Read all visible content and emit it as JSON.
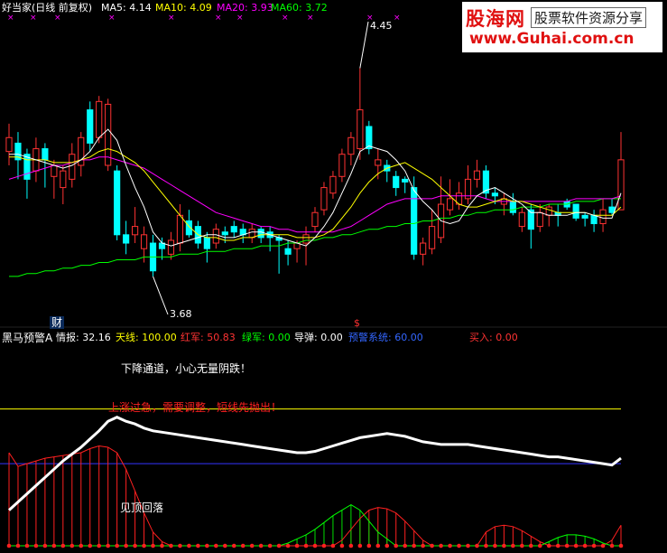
{
  "top_header": {
    "title": "好当家(日线 前复权)",
    "ma": [
      {
        "label": "MA5:",
        "value": "4.14",
        "color": "#ffffff"
      },
      {
        "label": "MA10:",
        "value": "4.09",
        "color": "#ffff00"
      },
      {
        "label": "MA20:",
        "value": "3.93",
        "color": "#ff00ff"
      },
      {
        "label": "MA60:",
        "value": "3.72",
        "color": "#00ff00"
      }
    ]
  },
  "logo": {
    "main": "股海网",
    "tagline": "股票软件资源分享",
    "url": "www.Guhai.com.cn"
  },
  "price_annotations": {
    "high": "4.45",
    "low": "3.68"
  },
  "markers": {
    "cai": "财",
    "s": "$"
  },
  "indicator_header": {
    "name": "黑马预警A",
    "items": [
      {
        "label": "情报:",
        "value": "32.16",
        "color": "#ffffff"
      },
      {
        "label": "天线:",
        "value": "100.00",
        "color": "#ffff00"
      },
      {
        "label": "红军:",
        "value": "50.83",
        "color": "#ff3333"
      },
      {
        "label": "绿军:",
        "value": "0.00",
        "color": "#00ff00"
      },
      {
        "label": "导弹:",
        "value": "0.00",
        "color": "#ffffff"
      },
      {
        "label": "预警系统:",
        "value": "60.00",
        "color": "#3366ff"
      },
      {
        "label": "买入:",
        "value": "0.00",
        "color": "#ff3333"
      }
    ]
  },
  "indicator_annotations": {
    "a1": "下降通道，小心无量阴跌！",
    "a2": "上涨过急，需要调整，短线先抛出！",
    "a3": "见顶回落"
  },
  "colors": {
    "up": "#ff3232",
    "down": "#00ffff",
    "ma5": "#ffffff",
    "ma10": "#ffff00",
    "ma20": "#ff00ff",
    "ma60": "#00ff00",
    "warn_line": "#3333ff",
    "sky_line": "#ffff00"
  },
  "chart_data": {
    "type": "candlestick",
    "candles": [
      [
        4.15,
        4.2,
        4.1,
        4.25
      ],
      [
        4.18,
        4.12,
        4.05,
        4.22
      ],
      [
        4.14,
        4.05,
        3.98,
        4.16
      ],
      [
        4.08,
        4.16,
        4.04,
        4.2
      ],
      [
        4.16,
        4.12,
        4.02,
        4.18
      ],
      [
        4.06,
        4.1,
        3.98,
        4.12
      ],
      [
        4.02,
        4.08,
        3.96,
        4.1
      ],
      [
        4.05,
        4.14,
        4.02,
        4.18
      ],
      [
        4.1,
        4.2,
        4.06,
        4.22
      ],
      [
        4.3,
        4.18,
        4.15,
        4.33
      ],
      [
        4.2,
        4.33,
        4.18,
        4.35
      ],
      [
        4.1,
        4.32,
        4.08,
        4.34
      ],
      [
        4.08,
        3.85,
        3.83,
        4.1
      ],
      [
        3.85,
        3.82,
        3.78,
        3.9
      ],
      [
        3.85,
        3.88,
        3.82,
        3.95
      ],
      [
        3.8,
        3.85,
        3.75,
        3.88
      ],
      [
        3.82,
        3.72,
        3.7,
        3.85
      ],
      [
        3.82,
        3.8,
        3.76,
        3.84
      ],
      [
        3.78,
        3.83,
        3.76,
        3.86
      ],
      [
        3.82,
        3.92,
        3.79,
        3.96
      ],
      [
        3.9,
        3.85,
        3.84,
        3.94
      ],
      [
        3.88,
        3.82,
        3.8,
        3.9
      ],
      [
        3.84,
        3.8,
        3.75,
        3.86
      ],
      [
        3.82,
        3.87,
        3.8,
        3.89
      ],
      [
        3.86,
        3.85,
        3.82,
        3.88
      ],
      [
        3.88,
        3.86,
        3.84,
        3.9
      ],
      [
        3.87,
        3.85,
        3.82,
        3.89
      ],
      [
        3.84,
        3.87,
        3.82,
        3.89
      ],
      [
        3.87,
        3.84,
        3.82,
        3.88
      ],
      [
        3.86,
        3.84,
        3.79,
        3.88
      ],
      [
        3.84,
        3.83,
        3.71,
        3.85
      ],
      [
        3.8,
        3.78,
        3.74,
        3.83
      ],
      [
        3.8,
        3.82,
        3.75,
        3.83
      ],
      [
        3.82,
        3.85,
        3.74,
        3.88
      ],
      [
        3.88,
        3.93,
        3.86,
        3.95
      ],
      [
        3.94,
        4.02,
        3.92,
        4.04
      ],
      [
        4.0,
        4.06,
        3.98,
        4.08
      ],
      [
        4.06,
        4.14,
        4.04,
        4.16
      ],
      [
        4.14,
        4.2,
        4.1,
        4.22
      ],
      [
        4.16,
        4.3,
        4.12,
        4.45
      ],
      [
        4.24,
        4.16,
        4.14,
        4.26
      ],
      [
        4.1,
        4.12,
        4.05,
        4.16
      ],
      [
        4.1,
        4.08,
        4.04,
        4.12
      ],
      [
        4.06,
        4.02,
        3.99,
        4.08
      ],
      [
        4.05,
        4.04,
        4.0,
        4.06
      ],
      [
        4.02,
        3.78,
        3.76,
        4.06
      ],
      [
        3.78,
        3.82,
        3.74,
        3.84
      ],
      [
        3.8,
        3.88,
        3.78,
        3.94
      ],
      [
        3.84,
        3.96,
        3.82,
        4.06
      ],
      [
        3.94,
        3.98,
        3.92,
        4.05
      ],
      [
        3.96,
        4.0,
        3.94,
        4.04
      ],
      [
        3.98,
        4.05,
        3.96,
        4.1
      ],
      [
        4.05,
        4.08,
        4.02,
        4.12
      ],
      [
        4.08,
        4.0,
        3.98,
        4.1
      ],
      [
        4.0,
        3.99,
        3.96,
        4.02
      ],
      [
        3.96,
        3.98,
        3.92,
        4.0
      ],
      [
        3.97,
        3.93,
        3.92,
        4.0
      ],
      [
        3.88,
        3.93,
        3.86,
        3.95
      ],
      [
        3.94,
        3.87,
        3.8,
        3.96
      ],
      [
        3.88,
        3.93,
        3.86,
        3.96
      ],
      [
        3.92,
        3.95,
        3.88,
        3.96
      ],
      [
        3.93,
        3.92,
        3.88,
        3.96
      ],
      [
        3.97,
        3.95,
        3.94,
        3.98
      ],
      [
        3.96,
        3.91,
        3.9,
        3.96
      ],
      [
        3.92,
        3.91,
        3.88,
        3.93
      ],
      [
        3.92,
        3.89,
        3.86,
        3.94
      ],
      [
        3.89,
        3.94,
        3.86,
        3.98
      ],
      [
        3.95,
        3.93,
        3.92,
        3.98
      ],
      [
        3.94,
        4.12,
        3.94,
        4.22
      ]
    ],
    "ma5": [
      4.14,
      4.14,
      4.13,
      4.12,
      4.11,
      4.1,
      4.09,
      4.1,
      4.12,
      4.15,
      4.2,
      4.23,
      4.19,
      4.1,
      4.02,
      3.95,
      3.86,
      3.82,
      3.81,
      3.82,
      3.83,
      3.84,
      3.85,
      3.85,
      3.84,
      3.84,
      3.85,
      3.86,
      3.86,
      3.85,
      3.84,
      3.83,
      3.82,
      3.81,
      3.84,
      3.88,
      3.93,
      4.0,
      4.07,
      4.15,
      4.17,
      4.16,
      4.15,
      4.12,
      4.08,
      4.01,
      3.97,
      3.94,
      3.9,
      3.89,
      3.9,
      3.95,
      3.99,
      4.01,
      4.02,
      4.0,
      3.98,
      3.96,
      3.93,
      3.93,
      3.92,
      3.92,
      3.92,
      3.93,
      3.93,
      3.92,
      3.91,
      3.91,
      4.0
    ],
    "ma10": [
      4.13,
      4.13,
      4.12,
      4.12,
      4.12,
      4.11,
      4.11,
      4.11,
      4.12,
      4.13,
      4.15,
      4.16,
      4.15,
      4.13,
      4.11,
      4.08,
      4.04,
      4.0,
      3.96,
      3.92,
      3.88,
      3.85,
      3.84,
      3.84,
      3.83,
      3.83,
      3.84,
      3.84,
      3.85,
      3.85,
      3.85,
      3.85,
      3.84,
      3.84,
      3.84,
      3.85,
      3.87,
      3.91,
      3.95,
      4.0,
      4.04,
      4.07,
      4.09,
      4.1,
      4.11,
      4.09,
      4.07,
      4.05,
      4.02,
      3.99,
      3.96,
      3.95,
      3.95,
      3.96,
      3.97,
      3.98,
      3.97,
      3.97,
      3.96,
      3.95,
      3.94,
      3.93,
      3.93,
      3.93,
      3.93,
      3.92,
      3.92,
      3.92,
      3.95
    ],
    "ma20": [
      4.05,
      4.06,
      4.07,
      4.08,
      4.09,
      4.1,
      4.1,
      4.11,
      4.12,
      4.12,
      4.13,
      4.13,
      4.12,
      4.11,
      4.1,
      4.09,
      4.07,
      4.05,
      4.03,
      4.01,
      3.99,
      3.97,
      3.95,
      3.93,
      3.92,
      3.91,
      3.9,
      3.89,
      3.88,
      3.88,
      3.87,
      3.87,
      3.86,
      3.86,
      3.86,
      3.86,
      3.86,
      3.87,
      3.88,
      3.9,
      3.92,
      3.94,
      3.96,
      3.97,
      3.98,
      3.98,
      3.98,
      3.98,
      3.99,
      3.99,
      3.99,
      3.99,
      3.99,
      3.98,
      3.97,
      3.97,
      3.97,
      3.97,
      3.97,
      3.97,
      3.97,
      3.97,
      3.97,
      3.98,
      3.98,
      3.98,
      3.98,
      3.98,
      3.99
    ],
    "ma60": [
      3.7,
      3.7,
      3.71,
      3.71,
      3.72,
      3.72,
      3.73,
      3.73,
      3.74,
      3.74,
      3.75,
      3.75,
      3.76,
      3.76,
      3.76,
      3.77,
      3.77,
      3.77,
      3.77,
      3.78,
      3.78,
      3.78,
      3.79,
      3.79,
      3.79,
      3.8,
      3.8,
      3.8,
      3.81,
      3.81,
      3.81,
      3.82,
      3.82,
      3.83,
      3.83,
      3.84,
      3.84,
      3.85,
      3.85,
      3.86,
      3.87,
      3.87,
      3.88,
      3.88,
      3.89,
      3.89,
      3.9,
      3.9,
      3.91,
      3.91,
      3.92,
      3.92,
      3.93,
      3.93,
      3.94,
      3.94,
      3.94,
      3.95,
      3.95,
      3.95,
      3.96,
      3.96,
      3.96,
      3.97,
      3.97,
      3.97,
      3.98,
      3.98,
      3.98
    ],
    "ylim": [
      3.55,
      4.65
    ],
    "indicator": {
      "ylim": [
        0,
        140
      ],
      "white_line": [
        26,
        32,
        38,
        44,
        50,
        56,
        62,
        67,
        72,
        78,
        84,
        91,
        94,
        91,
        89,
        86,
        84,
        83,
        82,
        81,
        80,
        79,
        78,
        77,
        76,
        75,
        74,
        73,
        72,
        71,
        70,
        69,
        68,
        68,
        69,
        71,
        73,
        75,
        77,
        79,
        80,
        81,
        82,
        81,
        80,
        78,
        76,
        75,
        74,
        74,
        74,
        74,
        73,
        72,
        71,
        70,
        69,
        68,
        67,
        66,
        65,
        65,
        64,
        63,
        62,
        61,
        60,
        59,
        64
      ],
      "red_hist": [
        68,
        58,
        60,
        62,
        64,
        65,
        66,
        67,
        68,
        71,
        73,
        72,
        68,
        56,
        40,
        24,
        10,
        3,
        0,
        0,
        0,
        0,
        0,
        0,
        0,
        0,
        0,
        0,
        0,
        0,
        0,
        0,
        0,
        0,
        0,
        0,
        0,
        4,
        12,
        20,
        26,
        28,
        27,
        24,
        18,
        11,
        4,
        0,
        0,
        0,
        0,
        0,
        0,
        10,
        14,
        15,
        14,
        11,
        7,
        3,
        0,
        0,
        0,
        0,
        0,
        0,
        0,
        4,
        15
      ],
      "green_hist": [
        0,
        0,
        0,
        0,
        0,
        0,
        0,
        0,
        0,
        0,
        0,
        0,
        0,
        0,
        0,
        0,
        0,
        0,
        0,
        0,
        0,
        0,
        0,
        0,
        0,
        0,
        0,
        0,
        0,
        0,
        0,
        2,
        5,
        8,
        12,
        17,
        22,
        26,
        30,
        26,
        18,
        10,
        5,
        0,
        0,
        0,
        0,
        0,
        0,
        0,
        0,
        0,
        0,
        0,
        0,
        0,
        0,
        0,
        0,
        0,
        3,
        6,
        8,
        8,
        7,
        5,
        2,
        0,
        0
      ],
      "warn_level": 60,
      "sky_level": 100,
      "red_line_level": 100
    }
  }
}
